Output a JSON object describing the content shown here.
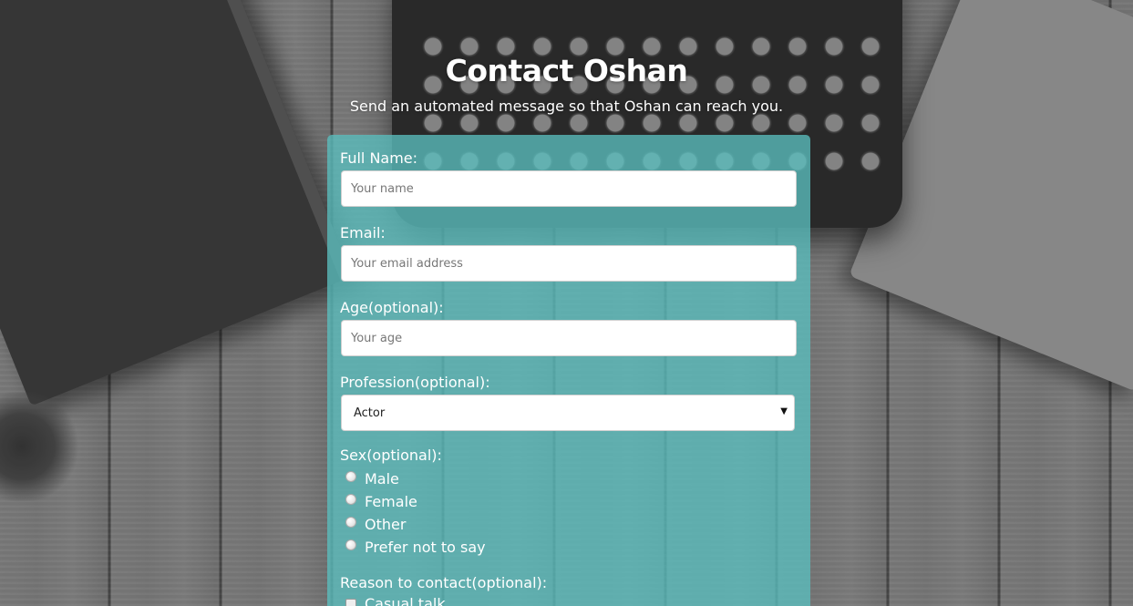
{
  "header": {
    "title": "Contact Oshan",
    "subtitle": "Send an automated message so that Oshan can reach you."
  },
  "form": {
    "full_name": {
      "label": "Full Name:",
      "placeholder": "Your name",
      "value": ""
    },
    "email": {
      "label": "Email:",
      "placeholder": "Your email address",
      "value": ""
    },
    "age": {
      "label": "Age(optional):",
      "placeholder": "Your age",
      "value": ""
    },
    "profession": {
      "label": "Profession(optional):",
      "selected": "Actor"
    },
    "sex": {
      "label": "Sex(optional):",
      "options": [
        "Male",
        "Female",
        "Other",
        "Prefer not to say"
      ]
    },
    "reason": {
      "label": "Reason to contact(optional):",
      "options": [
        "Casual talk"
      ]
    }
  },
  "colors": {
    "panel": "#5abebe",
    "text": "#ffffff"
  }
}
